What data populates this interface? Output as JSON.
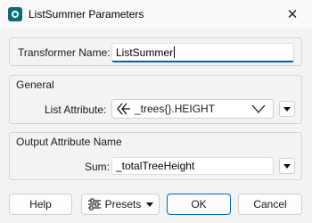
{
  "window": {
    "title": "ListSummer Parameters",
    "close_glyph": "✕",
    "app_icon": "fme-transformer-icon"
  },
  "transformer_name": {
    "label": "Transformer Name:",
    "value": "ListSummer"
  },
  "general": {
    "heading": "General",
    "list_attribute_label": "List Attribute:",
    "list_attribute_value": "_trees{}.HEIGHT",
    "list_attribute_icon": "list-attribute-icon"
  },
  "output": {
    "heading": "Output Attribute Name",
    "sum_label": "Sum:",
    "sum_value": "_totalTreeHeight"
  },
  "buttons": {
    "help": "Help",
    "presets": "Presets",
    "ok": "OK",
    "cancel": "Cancel"
  },
  "colors": {
    "accent": "#005fb8",
    "ok_border": "#0067c0",
    "app_icon": "#0b6b78"
  }
}
